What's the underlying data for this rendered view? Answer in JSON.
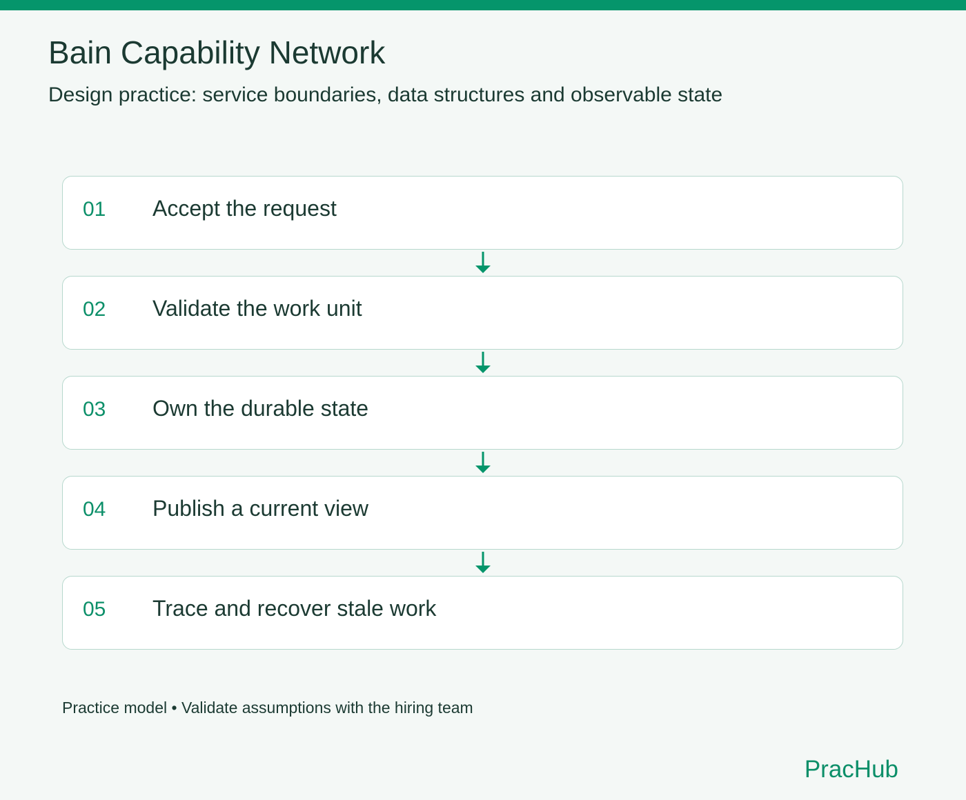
{
  "header": {
    "title": "Bain Capability Network",
    "subtitle": "Design practice: service boundaries, data structures and observable state"
  },
  "steps": [
    {
      "number": "01",
      "label": "Accept the request"
    },
    {
      "number": "02",
      "label": "Validate the work unit"
    },
    {
      "number": "03",
      "label": "Own the durable state"
    },
    {
      "number": "04",
      "label": "Publish a current view"
    },
    {
      "number": "05",
      "label": "Trace and recover stale work"
    }
  ],
  "footer": {
    "note": "Practice model • Validate assumptions with the hiring team",
    "brand": "PracHub"
  },
  "colors": {
    "accent": "#05956b",
    "accent_text": "#0c8f69",
    "text": "#1b3a32",
    "box_border": "#b7d8cd",
    "background": "#f4f8f6"
  },
  "icons": {
    "connector": "arrow-down-icon"
  }
}
